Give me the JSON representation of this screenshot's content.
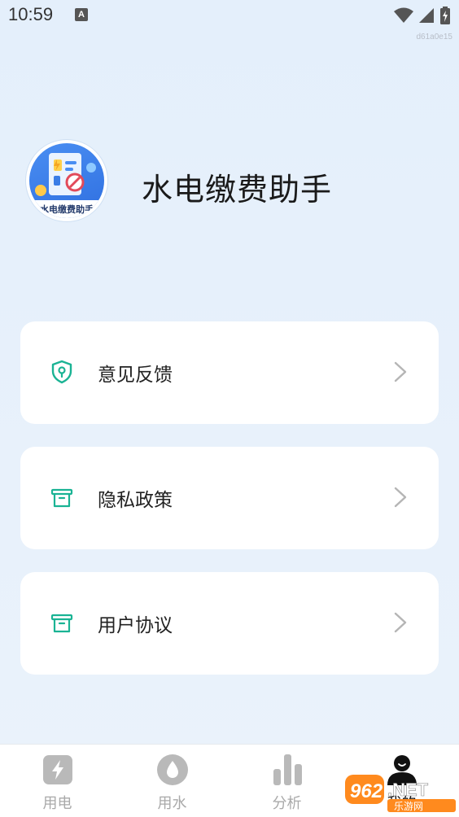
{
  "status_bar": {
    "time": "10:59",
    "notification_icon": "a-icon",
    "icons": [
      "wifi-icon",
      "signal-icon",
      "battery-icon"
    ]
  },
  "build_tag": "d61a0e15",
  "header": {
    "logo_caption": "水电缴费助手",
    "app_title": "水电缴费助手"
  },
  "menu": [
    {
      "label": "意见反馈",
      "icon": "shield-icon"
    },
    {
      "label": "隐私政策",
      "icon": "gift-box-icon"
    },
    {
      "label": "用户协议",
      "icon": "gift-box-icon"
    }
  ],
  "bottom_nav": [
    {
      "label": "用电",
      "icon": "lightning-icon",
      "active": false
    },
    {
      "label": "用水",
      "icon": "water-drop-icon",
      "active": false
    },
    {
      "label": "分析",
      "icon": "bar-chart-icon",
      "active": false
    },
    {
      "label": "我的",
      "icon": "user-icon",
      "active": true
    }
  ],
  "watermark": {
    "text": "962.NET",
    "subtext": "乐游网"
  },
  "colors": {
    "accent": "#1ab394",
    "nav_inactive": "#a9a9a9",
    "background": "#e6f0fb"
  }
}
